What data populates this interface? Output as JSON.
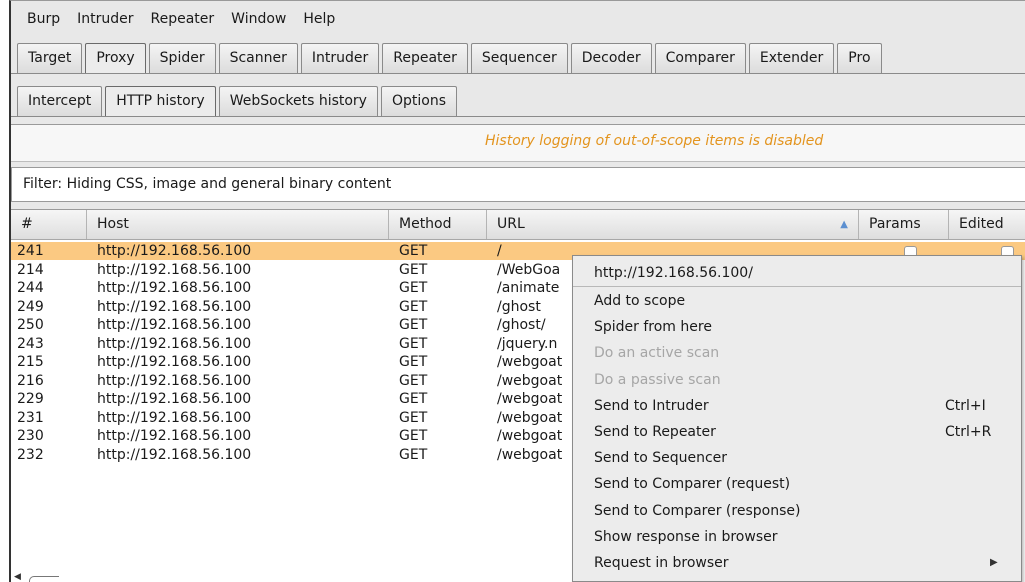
{
  "menu": [
    "Burp",
    "Intruder",
    "Repeater",
    "Window",
    "Help"
  ],
  "main_tabs": [
    "Target",
    "Proxy",
    "Spider",
    "Scanner",
    "Intruder",
    "Repeater",
    "Sequencer",
    "Decoder",
    "Comparer",
    "Extender",
    "Pro"
  ],
  "main_tab_active": "Proxy",
  "sub_tabs": [
    "Intercept",
    "HTTP history",
    "WebSockets history",
    "Options"
  ],
  "sub_tab_active": "HTTP history",
  "scope_warning": "History logging of out-of-scope items is disabled",
  "filter_text": "Filter: Hiding CSS, image and general binary content",
  "columns": {
    "num": "#",
    "host": "Host",
    "method": "Method",
    "url": "URL",
    "params": "Params",
    "edited": "Edited"
  },
  "rows": [
    {
      "num": "241",
      "host": "http://192.168.56.100",
      "method": "GET",
      "url": "/",
      "selected": true
    },
    {
      "num": "214",
      "host": "http://192.168.56.100",
      "method": "GET",
      "url": "/WebGoa"
    },
    {
      "num": "244",
      "host": "http://192.168.56.100",
      "method": "GET",
      "url": "/animate"
    },
    {
      "num": "249",
      "host": "http://192.168.56.100",
      "method": "GET",
      "url": "/ghost"
    },
    {
      "num": "250",
      "host": "http://192.168.56.100",
      "method": "GET",
      "url": "/ghost/"
    },
    {
      "num": "243",
      "host": "http://192.168.56.100",
      "method": "GET",
      "url": "/jquery.n"
    },
    {
      "num": "215",
      "host": "http://192.168.56.100",
      "method": "GET",
      "url": "/webgoat"
    },
    {
      "num": "216",
      "host": "http://192.168.56.100",
      "method": "GET",
      "url": "/webgoat"
    },
    {
      "num": "229",
      "host": "http://192.168.56.100",
      "method": "GET",
      "url": "/webgoat"
    },
    {
      "num": "231",
      "host": "http://192.168.56.100",
      "method": "GET",
      "url": "/webgoat"
    },
    {
      "num": "230",
      "host": "http://192.168.56.100",
      "method": "GET",
      "url": "/webgoat"
    },
    {
      "num": "232",
      "host": "http://192.168.56.100",
      "method": "GET",
      "url": "/webgoat"
    }
  ],
  "context_menu": {
    "header": "http://192.168.56.100/",
    "items": [
      {
        "label": "Add to scope",
        "enabled": true
      },
      {
        "label": "Spider from here",
        "enabled": true
      },
      {
        "label": "Do an active scan",
        "enabled": false
      },
      {
        "label": "Do a passive scan",
        "enabled": false
      },
      {
        "label": "Send to Intruder",
        "enabled": true,
        "shortcut": "Ctrl+I"
      },
      {
        "label": "Send to Repeater",
        "enabled": true,
        "shortcut": "Ctrl+R"
      },
      {
        "label": "Send to Sequencer",
        "enabled": true
      },
      {
        "label": "Send to Comparer (request)",
        "enabled": true
      },
      {
        "label": "Send to Comparer (response)",
        "enabled": true
      },
      {
        "label": "Show response in browser",
        "enabled": true
      },
      {
        "label": "Request in browser",
        "enabled": true,
        "submenu": true
      }
    ]
  },
  "colors": {
    "selected_row": "#fbc982",
    "warning_text": "#e3941e",
    "sort_arrow": "#5b8fd0"
  },
  "icons": {
    "sort": "sort-ascending-icon",
    "submenu": "submenu-arrow-icon"
  }
}
